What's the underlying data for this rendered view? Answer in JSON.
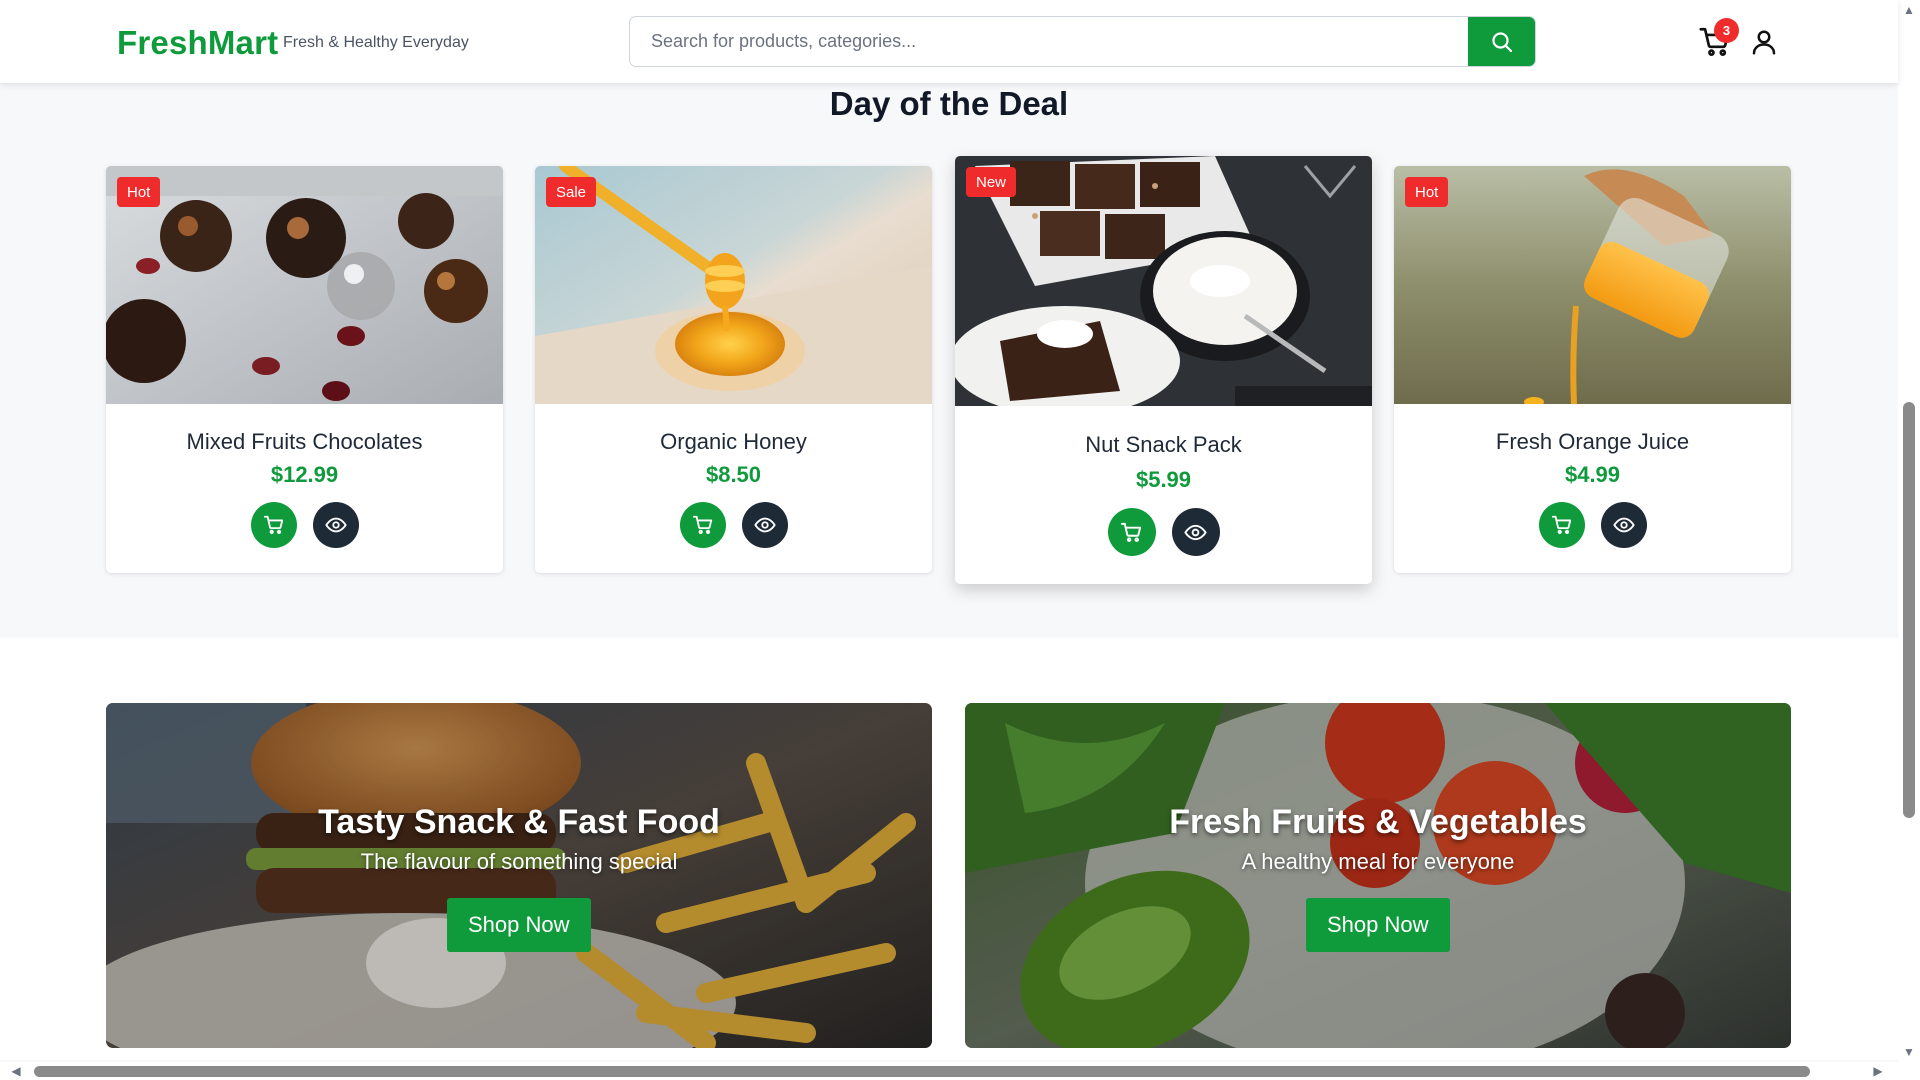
{
  "header": {
    "logo": "FreshMart",
    "tagline": "Fresh & Healthy Everyday",
    "search_placeholder": "Search for products, categories...",
    "search_icon": "search-icon",
    "cart_icon": "cart-icon",
    "cart_count": "3",
    "user_icon": "user-icon"
  },
  "deals": {
    "title": "Day of the Deal",
    "products": [
      {
        "badge": "Hot",
        "name": "Mixed Fruits Chocolates",
        "price": "$12.99"
      },
      {
        "badge": "Sale",
        "name": "Organic Honey",
        "price": "$8.50"
      },
      {
        "badge": "New",
        "name": "Nut Snack Pack",
        "price": "$5.99"
      },
      {
        "badge": "Hot",
        "name": "Fresh Orange Juice",
        "price": "$4.99"
      }
    ]
  },
  "banners": [
    {
      "title": "Tasty Snack & Fast Food",
      "subtitle": "The flavour of something special",
      "button": "Shop Now"
    },
    {
      "title": "Fresh Fruits & Vegetables",
      "subtitle": "A healthy meal for everyone",
      "button": "Shop Now"
    }
  ],
  "colors": {
    "brand_green": "#0f9a3c",
    "badge_red": "#ef2b2b",
    "dark_button": "#1f2a37",
    "page_bg": "#f7f8fa"
  }
}
